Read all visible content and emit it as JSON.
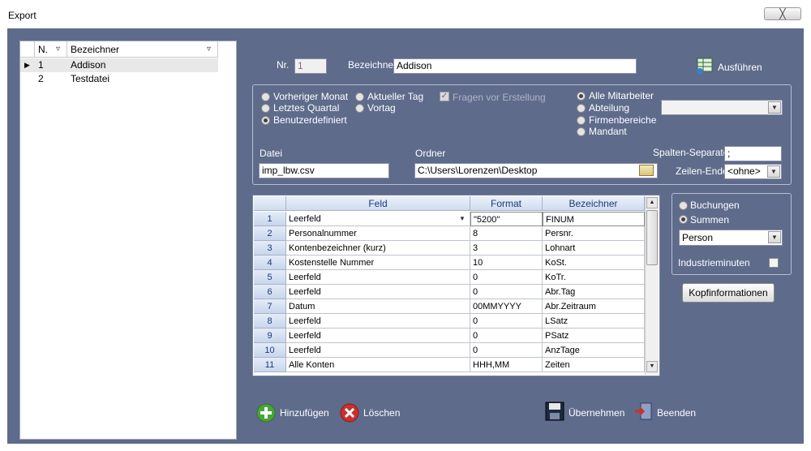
{
  "window": {
    "title": "Export",
    "close_label": "╳"
  },
  "list": {
    "headers": {
      "nr": "N.",
      "name": "Bezeichner"
    },
    "rows": [
      {
        "nr": "1",
        "name": "Addison"
      },
      {
        "nr": "2",
        "name": "Testdatei"
      }
    ]
  },
  "form": {
    "nr_label": "Nr.",
    "nr_value": "1",
    "name_label": "Bezeichner",
    "name_value": "Addison",
    "run_label": "Ausführen",
    "period": {
      "prev_month": "Vorheriger Monat",
      "last_quarter": "Letztes Quartal",
      "custom": "Benutzerdefiniert",
      "today": "Aktueller Tag",
      "yesterday": "Vortag",
      "ask_label": "Fragen vor Erstellung",
      "selected": "custom"
    },
    "scope": {
      "all": "Alle Mitarbeiter",
      "department": "Abteilung",
      "company_areas": "Firmenbereiche",
      "client": "Mandant",
      "selected": "all",
      "select_value": ""
    },
    "file_label": "Datei",
    "file_value": "imp_lbw.csv",
    "folder_label": "Ordner",
    "folder_value": "C:\\Users\\Lorenzen\\Desktop",
    "sep_label": "Spalten-Separator",
    "sep_value": ";",
    "eol_label": "Zeilen-Ende",
    "eol_value": "<ohne>"
  },
  "grid": {
    "headers": {
      "field": "Feld",
      "format": "Format",
      "name": "Bezeichner"
    },
    "rows": [
      {
        "n": "1",
        "field": "Leerfeld",
        "format": "\"5200\"",
        "name": "FINUM"
      },
      {
        "n": "2",
        "field": "Personalnummer",
        "format": "8",
        "name": "Persnr."
      },
      {
        "n": "3",
        "field": "Kontenbezeichner (kurz)",
        "format": "3",
        "name": "Lohnart"
      },
      {
        "n": "4",
        "field": "Kostenstelle Nummer",
        "format": "10",
        "name": "KoSt."
      },
      {
        "n": "5",
        "field": "Leerfeld",
        "format": "0",
        "name": "KoTr."
      },
      {
        "n": "6",
        "field": "Leerfeld",
        "format": "0",
        "name": "Abr.Tag"
      },
      {
        "n": "7",
        "field": "Datum",
        "format": "00MMYYYY",
        "name": "Abr.Zeitraum"
      },
      {
        "n": "8",
        "field": "Leerfeld",
        "format": "0",
        "name": "LSatz"
      },
      {
        "n": "9",
        "field": "Leerfeld",
        "format": "0",
        "name": "PSatz"
      },
      {
        "n": "10",
        "field": "Leerfeld",
        "format": "0",
        "name": "AnzTage"
      },
      {
        "n": "11",
        "field": "Alle Konten",
        "format": "HHH,MM",
        "name": "Zeiten"
      }
    ]
  },
  "side": {
    "bookings": "Buchungen",
    "sums": "Summen",
    "selected": "sums",
    "person_value": "Person",
    "industry_label": "Industrieminuten",
    "header_btn": "Kopfinformationen"
  },
  "actions": {
    "add": "Hinzufügen",
    "delete": "Löschen",
    "apply": "Übernehmen",
    "quit": "Beenden"
  },
  "colors": {
    "client_bg": "#5e6b8b",
    "grid_header_text": "#1c3a78"
  }
}
